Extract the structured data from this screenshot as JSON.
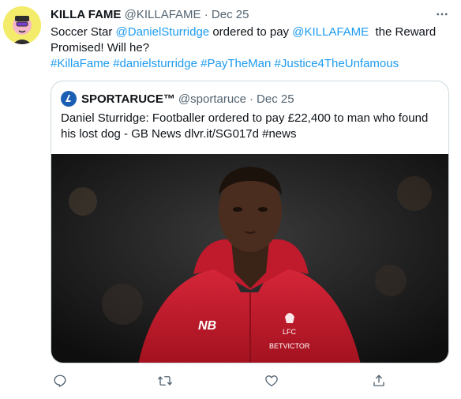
{
  "tweet": {
    "author_name": "KILLA FAME",
    "author_handle": "@KILLAFAME",
    "separator": "·",
    "date": "Dec 25",
    "text_parts": {
      "p1": "Soccer Star ",
      "mention1": "@DanielSturridge",
      "p2": " ordered to pay ",
      "mention2": "@KILLAFAME",
      "p3": "  the Reward Promised! Will he?"
    },
    "hashtags": [
      "#KillaFame",
      "#danielsturridge",
      "#PayTheMan",
      "#Justice4TheUnfamous"
    ]
  },
  "quote": {
    "author_name": "SPORTARUCE™",
    "author_handle": "@sportaruce",
    "separator": "·",
    "date": "Dec 25",
    "text": "Daniel Sturridge: Footballer ordered to pay £22,400 to man who found his lost dog - GB News dlvr.it/SG017d #news",
    "image_jersey_text": {
      "club": "LFC",
      "sponsor": "BETVICTOR"
    }
  },
  "icons": {
    "more": "more-horizontal-icon",
    "reply": "reply-icon",
    "retweet": "retweet-icon",
    "like": "like-icon",
    "share": "share-icon"
  },
  "colors": {
    "accent": "#1d9bf0",
    "secondary_text": "#536471",
    "jacket_red": "#c8202d",
    "quote_avatar": "#1a5fb4"
  }
}
